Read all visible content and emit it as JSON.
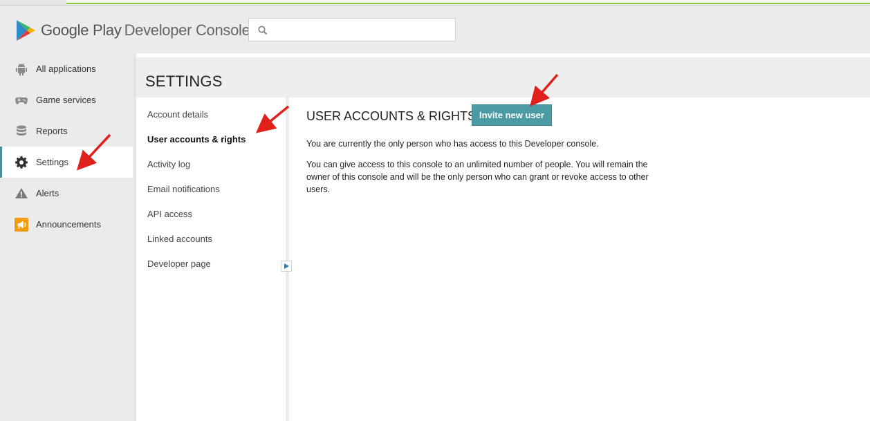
{
  "header": {
    "logo_text_brand": "Google Play",
    "logo_text_product": "Developer Console",
    "search": {
      "value": "",
      "placeholder": "",
      "icon": "search-icon"
    }
  },
  "sidebar": {
    "items": [
      {
        "label": "All applications",
        "icon": "android-icon",
        "active": false
      },
      {
        "label": "Game services",
        "icon": "gamepad-icon",
        "active": false
      },
      {
        "label": "Reports",
        "icon": "database-icon",
        "active": false
      },
      {
        "label": "Settings",
        "icon": "gear-icon",
        "active": true
      },
      {
        "label": "Alerts",
        "icon": "warning-icon",
        "active": false
      },
      {
        "label": "Announcements",
        "icon": "megaphone-icon",
        "active": false
      }
    ]
  },
  "settings": {
    "title": "SETTINGS",
    "subnav": [
      {
        "label": "Account details",
        "active": false
      },
      {
        "label": "User accounts & rights",
        "active": true
      },
      {
        "label": "Activity log",
        "active": false
      },
      {
        "label": "Email notifications",
        "active": false
      },
      {
        "label": "API access",
        "active": false
      },
      {
        "label": "Linked accounts",
        "active": false
      },
      {
        "label": "Developer page",
        "active": false
      }
    ]
  },
  "content": {
    "title": "USER ACCOUNTS & RIGHTS",
    "invite_button": "Invite new user",
    "para1": "You are currently the only person who has access to this Developer console.",
    "para2": "You can give access to this console to an unlimited number of people. You will remain the owner of this console and will be the only person who can grant or revoke access to other users."
  },
  "colors": {
    "accent": "#4a9ba4",
    "annotation_arrow": "#e0201b",
    "announcement_icon": "#f39c12"
  }
}
